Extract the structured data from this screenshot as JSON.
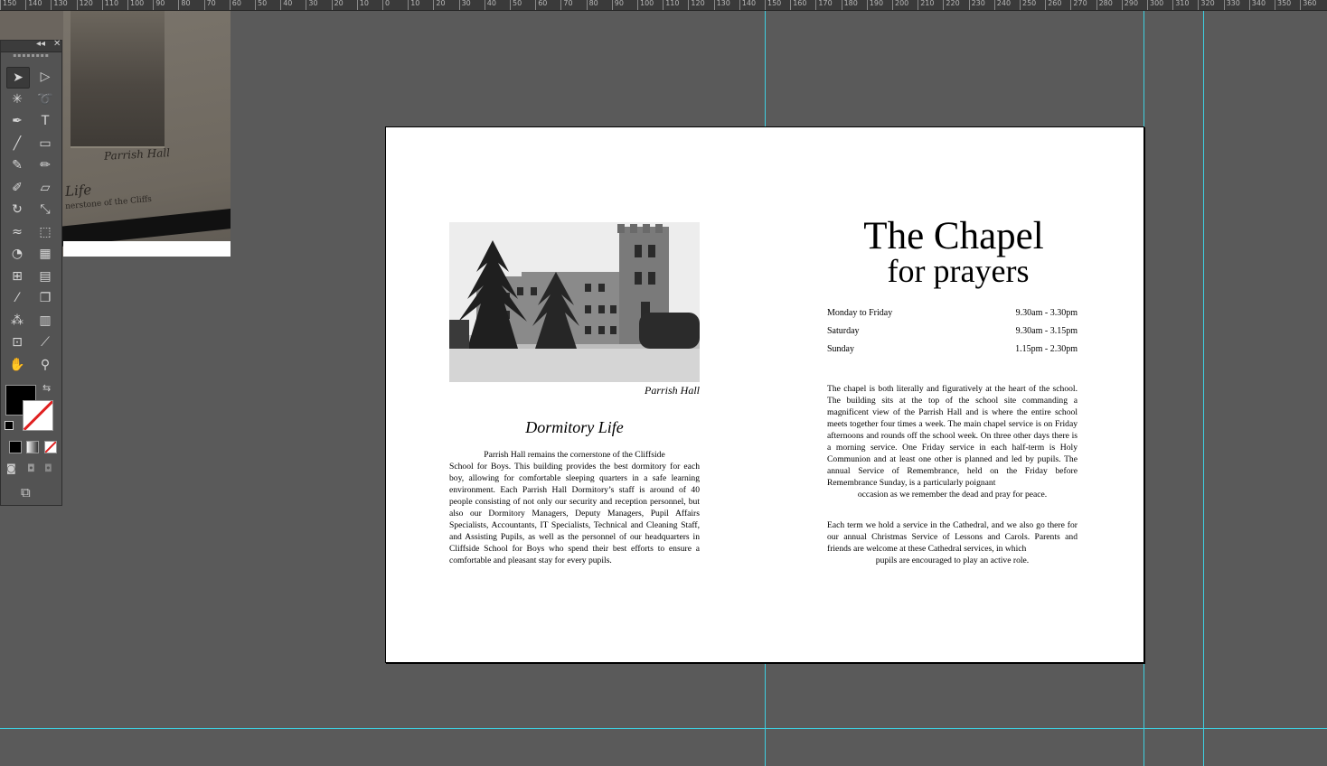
{
  "ruler": {
    "labels": [
      "150",
      "140",
      "130",
      "120",
      "110",
      "100",
      "90",
      "80",
      "70",
      "60",
      "50",
      "40",
      "30",
      "20",
      "10",
      "0",
      "10",
      "20",
      "30",
      "40",
      "50",
      "60",
      "70",
      "80",
      "90",
      "100",
      "110",
      "120",
      "130",
      "140",
      "150",
      "160",
      "170",
      "180",
      "190",
      "200",
      "210",
      "220",
      "230",
      "240",
      "250",
      "260",
      "270",
      "280",
      "290",
      "300",
      "310",
      "320",
      "330",
      "340",
      "350",
      "360"
    ]
  },
  "pasteboard": {
    "caption": "Parrish Hall",
    "title_fragment": "Life",
    "text_fragment": "nerstone of the Cliffs"
  },
  "tools": [
    {
      "name": "selection-tool",
      "icon": "arrow-icon",
      "glyph": "➤"
    },
    {
      "name": "direct-selection-tool",
      "icon": "white-arrow-icon",
      "glyph": "▷"
    },
    {
      "name": "magic-wand-tool",
      "icon": "magic-wand-icon",
      "glyph": "✳"
    },
    {
      "name": "lasso-tool",
      "icon": "lasso-icon",
      "glyph": "➰"
    },
    {
      "name": "pen-tool",
      "icon": "pen-icon",
      "glyph": "✒"
    },
    {
      "name": "type-tool",
      "icon": "type-icon",
      "glyph": "T"
    },
    {
      "name": "line-tool",
      "icon": "line-icon",
      "glyph": "╱"
    },
    {
      "name": "rectangle-tool",
      "icon": "rectangle-icon",
      "glyph": "▭"
    },
    {
      "name": "paintbrush-tool",
      "icon": "brush-icon",
      "glyph": "✎"
    },
    {
      "name": "pencil-tool",
      "icon": "pencil-icon",
      "glyph": "✏"
    },
    {
      "name": "blob-brush-tool",
      "icon": "blob-brush-icon",
      "glyph": "✐"
    },
    {
      "name": "eraser-tool",
      "icon": "eraser-icon",
      "glyph": "▱"
    },
    {
      "name": "rotate-tool",
      "icon": "rotate-icon",
      "glyph": "↻"
    },
    {
      "name": "scale-tool",
      "icon": "scale-icon",
      "glyph": "⤡"
    },
    {
      "name": "warp-tool",
      "icon": "warp-icon",
      "glyph": "≈"
    },
    {
      "name": "free-transform-tool",
      "icon": "free-transform-icon",
      "glyph": "⬚"
    },
    {
      "name": "shape-builder-tool",
      "icon": "shape-builder-icon",
      "glyph": "◔"
    },
    {
      "name": "perspective-grid-tool",
      "icon": "perspective-grid-icon",
      "glyph": "▦"
    },
    {
      "name": "mesh-tool",
      "icon": "mesh-icon",
      "glyph": "⊞"
    },
    {
      "name": "gradient-tool",
      "icon": "gradient-icon",
      "glyph": "▤"
    },
    {
      "name": "eyedropper-tool",
      "icon": "eyedropper-icon",
      "glyph": "⁄"
    },
    {
      "name": "blend-tool",
      "icon": "blend-icon",
      "glyph": "❐"
    },
    {
      "name": "symbol-sprayer-tool",
      "icon": "symbol-sprayer-icon",
      "glyph": "⁂"
    },
    {
      "name": "column-graph-tool",
      "icon": "graph-icon",
      "glyph": "▥"
    },
    {
      "name": "artboard-tool",
      "icon": "artboard-icon",
      "glyph": "⊡"
    },
    {
      "name": "slice-tool",
      "icon": "slice-icon",
      "glyph": "⟋"
    },
    {
      "name": "hand-tool",
      "icon": "hand-icon",
      "glyph": "✋"
    },
    {
      "name": "zoom-tool",
      "icon": "zoom-icon",
      "glyph": "⚲"
    }
  ],
  "left_page": {
    "photo_caption": "Parrish Hall",
    "title": "Dormitory Life",
    "body_first_line": "Parrish Hall remains the cornerstone of the Cliffside",
    "body": "School for Boys.  This building provides the best dormitory for each boy, allowing for comfortable sleeping quarters in a safe learning environment. Each Parrish Hall Dormitory’s staff is around of 40 people consisting of not only our security and reception personnel, but also our Dormitory Managers, Deputy Managers, Pupil Affairs Specialists, Accountants, IT Specialists, Technical and Cleaning Staff, and Assisting Pupils, as well as the personnel of our headquarters in Cliffside School for Boys who spend their best efforts to ensure a comfortable and pleasant stay for every pupils."
  },
  "right_page": {
    "title": "The Chapel",
    "subtitle": "for prayers",
    "schedule": [
      {
        "day": "Monday to Friday",
        "time": "9.30am - 3.30pm"
      },
      {
        "day": "Saturday",
        "time": "9.30am - 3.15pm"
      },
      {
        "day": "Sunday",
        "time": "1.15pm - 2.30pm"
      }
    ],
    "para1": "The chapel is both literally and figuratively at the heart of the school. The building sits at the top of the school site commanding a magnificent view of the Parrish Hall and is where the entire school meets together four times a week.  The main chapel service is on Friday afternoons and rounds off the school week. On three other days there is a morning service. One Friday service in each half-term is Holy Communion and at least one other is planned and led by pupils. The annual Service of Remembrance, held on the Friday before Remembrance Sunday, is a particularly poignant",
    "para1_last": "occasion as we remember the dead and pray for peace.",
    "para2": "Each term we hold a service in the Cathedral, and we also go there for our annual Christmas Service of Lessons and Carols. Parents and friends are welcome at these Cathedral services, in which",
    "para2_last": "pupils are encouraged to play an active role."
  },
  "colors": {
    "guide": "#3ecfe0",
    "pasteboard": "#5a5a5a",
    "panel": "#535353",
    "stroke_none": "#e02020"
  }
}
